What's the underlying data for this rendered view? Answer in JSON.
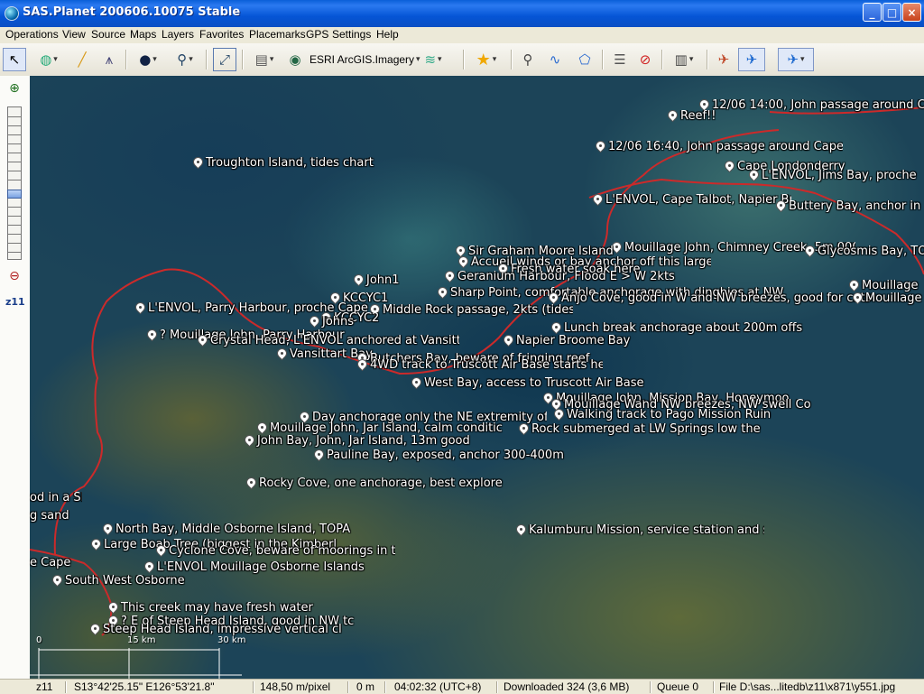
{
  "window": {
    "title": "SAS.Planet 200606.10075 Stable",
    "controls": {
      "minimize": "_",
      "maximize": "□",
      "close": "×"
    }
  },
  "menu": [
    "Operations",
    "View",
    "Source",
    "Maps",
    "Layers",
    "Favorites",
    "Placemarks",
    "GPS",
    "Settings",
    "Help"
  ],
  "toolbar": {
    "active_map": "ESRI ArcGIS.Imagery",
    "icons": [
      "cursor-icon",
      "globe-drop-icon",
      "ruler-icon",
      "compass-icon",
      "map-type-icon",
      "magnifier-drop-icon",
      "fullscreen-icon",
      "satellite-dish-icon",
      "earth-icon",
      "layers-icon",
      "favorites-star-icon",
      "placemark-icon",
      "path-icon",
      "polygon-icon",
      "placemarks-list-icon",
      "no-entry-icon",
      "gps-device-icon",
      "gps-connect-icon",
      "gps-track-icon",
      "gps-center-icon"
    ]
  },
  "zoom": {
    "label": "z11",
    "in_icon": "zoom-in-icon",
    "out_icon": "zoom-out-icon"
  },
  "placemarks": [
    {
      "label": "12/06 14:00, John passage around C"
    },
    {
      "label": "Reef!!"
    },
    {
      "label": "12/06 16:40, John passage around Cape"
    },
    {
      "label": "Troughton Island, tides chart"
    },
    {
      "label": "Cape Londonderry"
    },
    {
      "label": "L'ENVOL, Jims Bay, proche"
    },
    {
      "label": "L'ENVOL, Cape Talbot, Napier Broo"
    },
    {
      "label": "Buttery Bay, anchor in"
    },
    {
      "label": "Mouillage John, Chimney Creek, 5m 000"
    },
    {
      "label": "Glycosmis Bay, TO"
    },
    {
      "label": "Sir Graham Moore Island"
    },
    {
      "label": "Accueil winds or bay anchor off this large I"
    },
    {
      "label": "Fresh water soak here"
    },
    {
      "label": "Geranium Harbour, Flood E > W 2kts"
    },
    {
      "label": "John1"
    },
    {
      "label": "Sharp Point, comfortable anchorage with dinghies at NW"
    },
    {
      "label": "Anjo Cove, good in W and NW breezes, good for cats"
    },
    {
      "label": "KCCYC1"
    },
    {
      "label": "L'ENVOL, Parry Harbour, proche Cape Bo"
    },
    {
      "label": "Middle Rock passage, 2kts (tides"
    },
    {
      "label": "KCCYC2"
    },
    {
      "label": "Johns"
    },
    {
      "label": "Lunch break anchorage about 200m offs"
    },
    {
      "label": "Napier Broome Bay"
    },
    {
      "label": "? Mouillage John, Parry Harbour"
    },
    {
      "label": "Vansittart Bay"
    },
    {
      "label": "Crystal Head, L'ENVOL anchored at Vansittart Bay"
    },
    {
      "label": "Butchers Bay, beware of fringing reef, re"
    },
    {
      "label": "4WD track to Truscott Air Base starts he"
    },
    {
      "label": "West Bay, access to Truscott Air Base"
    },
    {
      "label": "Mouillage John, Mission Bay, Honeymoo"
    },
    {
      "label": "Mouillage Wand NW breezes, NW swell Co"
    },
    {
      "label": "Walking track to Pago Mission Ruin"
    },
    {
      "label": "Day anchorage only the NE extremity of the"
    },
    {
      "label": "Rock submerged at LW Springs low the"
    },
    {
      "label": "Mouillage John, Jar Island, calm conditic"
    },
    {
      "label": "John Bay, John, Jar Island, 13m good"
    },
    {
      "label": "Pauline Bay, exposed, anchor 300-400m"
    },
    {
      "label": "Rocky Cove, one anchorage, best explore"
    },
    {
      "label": "Kalumburu Mission, service station and s"
    },
    {
      "label": "North Bay, Middle Osborne Island, TOPA"
    },
    {
      "label": "Large Boab Tree (biggest in the Kimberl"
    },
    {
      "label": "Cyclone Cove, beware of moorings in the"
    },
    {
      "label": "South West Osborne Island"
    },
    {
      "label": "L'ENVOL Mouillage Osborne Islands"
    },
    {
      "label": "This creek may have fresh water"
    },
    {
      "label": "? E of Steep Head Island, good in NW tc"
    },
    {
      "label": "Steep Head Island, impressive vertical cl"
    },
    {
      "label": "Mouillage"
    },
    {
      "label": "Mouillage"
    },
    {
      "label": "od in a SE"
    },
    {
      "label": "g sand"
    },
    {
      "label": "e Cape"
    }
  ],
  "scale": {
    "labels": [
      "0",
      "15 km",
      "30 km"
    ]
  },
  "status": {
    "zoom": "z11",
    "coords": "S13°42'25.15\" E126°53'21.8\"",
    "resolution": "148,50 m/pixel",
    "altitude": "0 m",
    "time": "04:02:32 (UTC+8)",
    "downloaded": "Downloaded 324 (3,6 MB)",
    "queue": "Queue 0",
    "file": "File D:\\sas...litedb\\z11\\x871\\y551.jpg"
  }
}
